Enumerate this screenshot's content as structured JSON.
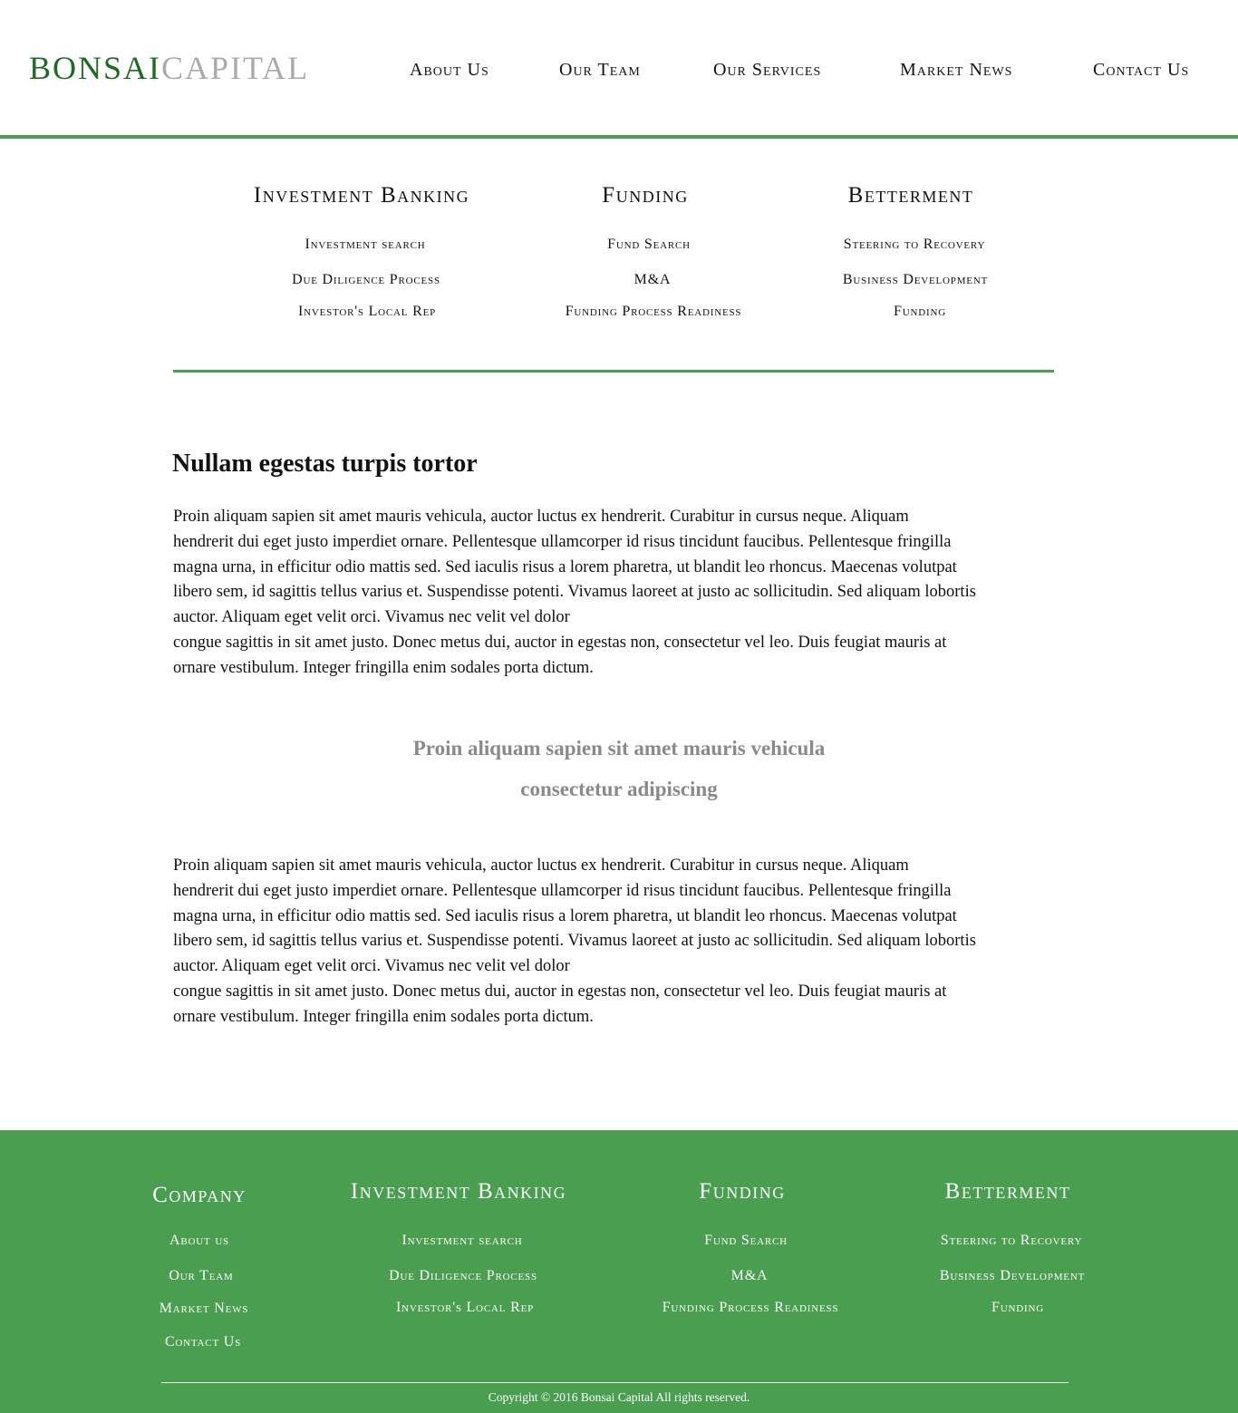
{
  "brand": {
    "name_part1": "BONSAI",
    "name_part2": "CAPITAL",
    "colors": {
      "green": "#1f6b22",
      "grey": "#a8aca8",
      "accent": "#4a9e50"
    }
  },
  "nav": [
    "About Us",
    "Our Team",
    "Our Services",
    "Market News",
    "Contact Us"
  ],
  "services": [
    {
      "title": "Investment Banking",
      "links": [
        "Investment search",
        "Due Diligence Process",
        "Investor's Local Rep"
      ]
    },
    {
      "title": "Funding",
      "links": [
        "Fund Search",
        "M&A",
        "Funding Process Readiness"
      ]
    },
    {
      "title": "Betterment",
      "links": [
        "Steering to Recovery",
        "Business Development",
        "Funding"
      ]
    }
  ],
  "main": {
    "heading": "Nullam egestas turpis tortor",
    "para1": {
      "lines": [
        "Proin aliquam sapien sit amet mauris vehicula, auctor luctus ex hendrerit. Curabitur in cursus neque. Aliquam",
        "hendrerit dui eget justo imperdiet ornare. Pellentesque ullamcorper id risus tincidunt faucibus. Pellentesque fringilla",
        "magna urna, in efficitur odio mattis sed. Sed iaculis risus a lorem pharetra, ut blandit leo rhoncus. Maecenas volutpat",
        "libero sem, id sagittis tellus varius et. Suspendisse potenti. Vivamus laoreet at justo ac sollicitudin. Sed aliquam lobortis",
        "auctor. Aliquam eget velit orci. Vivamus nec velit vel dolor",
        "congue sagittis in sit amet justo. Donec metus dui, auctor in egestas non, consectetur vel leo. Duis feugiat mauris at",
        "ornare vestibulum. Integer fringilla enim sodales porta dictum."
      ]
    },
    "quote": {
      "line1": "Proin aliquam sapien sit amet mauris vehicula",
      "line2": "consectetur adipiscing"
    },
    "para2": {
      "lines": [
        "Proin aliquam sapien sit amet mauris vehicula, auctor luctus ex hendrerit. Curabitur in cursus neque. Aliquam",
        "hendrerit dui eget justo imperdiet ornare. Pellentesque ullamcorper id risus tincidunt faucibus. Pellentesque fringilla",
        "magna urna, in efficitur odio mattis sed. Sed iaculis risus a lorem pharetra, ut blandit leo rhoncus. Maecenas volutpat",
        "libero sem, id sagittis tellus varius et. Suspendisse potenti. Vivamus laoreet at justo ac sollicitudin. Sed aliquam lobortis",
        "auctor. Aliquam eget velit orci. Vivamus nec velit vel dolor",
        "congue sagittis in sit amet justo. Donec metus dui, auctor in egestas non, consectetur vel leo. Duis feugiat mauris at",
        "ornare vestibulum. Integer fringilla enim sodales porta dictum."
      ]
    }
  },
  "footer": {
    "company": {
      "title": "Company",
      "links": [
        "About us",
        "Our Team",
        "Market News",
        "Contact Us"
      ]
    },
    "services": [
      {
        "title": "Investment Banking",
        "links": [
          "Investment search",
          "Due Diligence Process",
          "Investor's Local Rep"
        ]
      },
      {
        "title": "Funding",
        "links": [
          "Fund Search",
          "M&A",
          "Funding Process Readiness"
        ]
      },
      {
        "title": "Betterment",
        "links": [
          "Steering to Recovery",
          "Business Development",
          "Funding"
        ]
      }
    ],
    "copyright": "Copyright © 2016 Bonsai Capital All rights reserved."
  }
}
